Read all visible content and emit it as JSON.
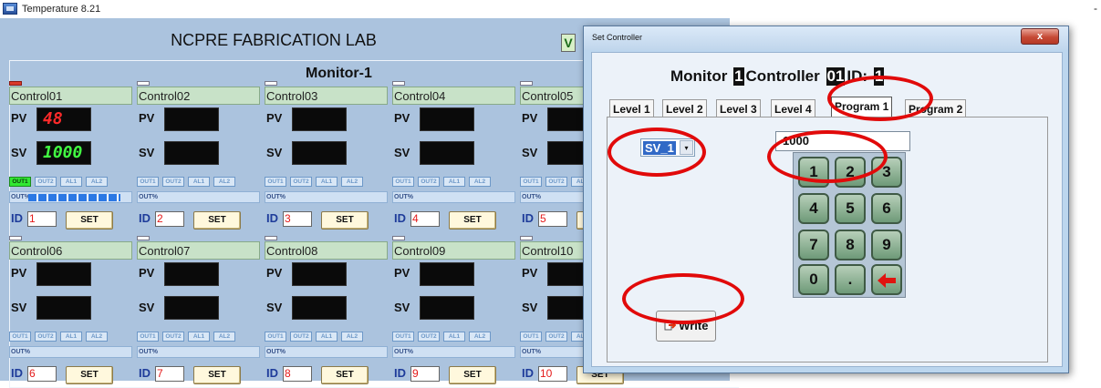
{
  "app": {
    "title": "Temperature 8.21",
    "min_glyph": "-"
  },
  "main": {
    "lab_title": "NCPRE FABRICATION LAB",
    "monitor_title": "Monitor-1",
    "v_tab": "V",
    "controllers": [
      {
        "name": "Control01",
        "pv": "48",
        "sv": "1000",
        "out_pct": "OUT%",
        "id": "1",
        "set": "SET"
      },
      {
        "name": "Control02",
        "pv": "",
        "sv": "",
        "out_pct": "OUT%",
        "id": "2",
        "set": "SET"
      },
      {
        "name": "Control03",
        "pv": "",
        "sv": "",
        "out_pct": "OUT%",
        "id": "3",
        "set": "SET"
      },
      {
        "name": "Control04",
        "pv": "",
        "sv": "",
        "out_pct": "OUT%",
        "id": "4",
        "set": "SET"
      },
      {
        "name": "Control05",
        "pv": "",
        "sv": "",
        "out_pct": "OUT%",
        "id": "5",
        "set": "SET"
      },
      {
        "name": "Control06",
        "pv": "",
        "sv": "",
        "out_pct": "OUT%",
        "id": "6",
        "set": "SET"
      },
      {
        "name": "Control07",
        "pv": "",
        "sv": "",
        "out_pct": "OUT%",
        "id": "7",
        "set": "SET"
      },
      {
        "name": "Control08",
        "pv": "",
        "sv": "",
        "out_pct": "OUT%",
        "id": "8",
        "set": "SET"
      },
      {
        "name": "Control09",
        "pv": "",
        "sv": "",
        "out_pct": "OUT%",
        "id": "9",
        "set": "SET"
      },
      {
        "name": "Control10",
        "pv": "",
        "sv": "",
        "out_pct": "OUT%",
        "id": "10",
        "set": "SET"
      }
    ],
    "labels": {
      "pv": "PV",
      "sv": "SV",
      "id": "ID",
      "out1": "OUT1",
      "out2": "OUT2",
      "al1": "AL1",
      "al2": "AL2"
    },
    "out_level_control01": 0.9
  },
  "dialog": {
    "title": "Set Controller",
    "close": "x",
    "header": {
      "monitor": "Monitor",
      "monitor_no": "1",
      "controller": "Controller",
      "controller_no": "01",
      "id_label": "ID:",
      "id_no": "1"
    },
    "tabs": [
      "Level 1",
      "Level 2",
      "Level 3",
      "Level 4",
      "Program 1",
      "Program 2"
    ],
    "active_tab": "Program 1",
    "combo_value": "SV_1",
    "combo_arrow": "▾",
    "input_value": "1000",
    "keys": [
      "1",
      "2",
      "3",
      "4",
      "5",
      "6",
      "7",
      "8",
      "9",
      "0",
      "."
    ],
    "write_label": "Write"
  },
  "colors": {
    "pv_digit": "#ff2a2a",
    "sv_digit": "#42ff42",
    "annotation_ring": "#e10a0a"
  }
}
